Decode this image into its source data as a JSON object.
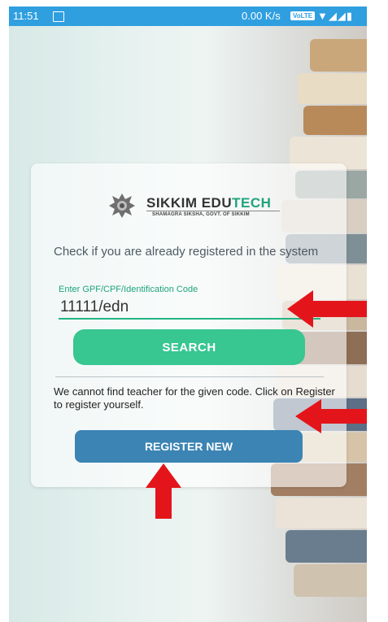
{
  "status_bar": {
    "time": "11:51",
    "network_speed": "0.00 K/s",
    "volte_badge": "VoLTE",
    "icons": [
      "image-icon",
      "volte-icon",
      "wifi-icon",
      "signal-icon",
      "battery-icon"
    ]
  },
  "logo": {
    "brand_main": "SIKKIM EDU",
    "brand_accent": "TECH",
    "subtitle": "SHAMAGRA SIKSHA, GOVT. OF SIKKIM"
  },
  "form": {
    "prompt": "Check if you are already registered in the system",
    "field_label": "Enter GPF/CPF/Identification Code",
    "code_value": "11111/edn",
    "search_label": "SEARCH",
    "result_message": "We cannot find teacher for the given code. Click on Register to register yourself.",
    "register_label": "REGISTER NEW"
  },
  "colors": {
    "status_bar": "#2f9fe0",
    "accent_green": "#1fa47d",
    "search_button": "#38c691",
    "register_button": "#3b84b4",
    "annotation_arrow": "#e3151b"
  }
}
